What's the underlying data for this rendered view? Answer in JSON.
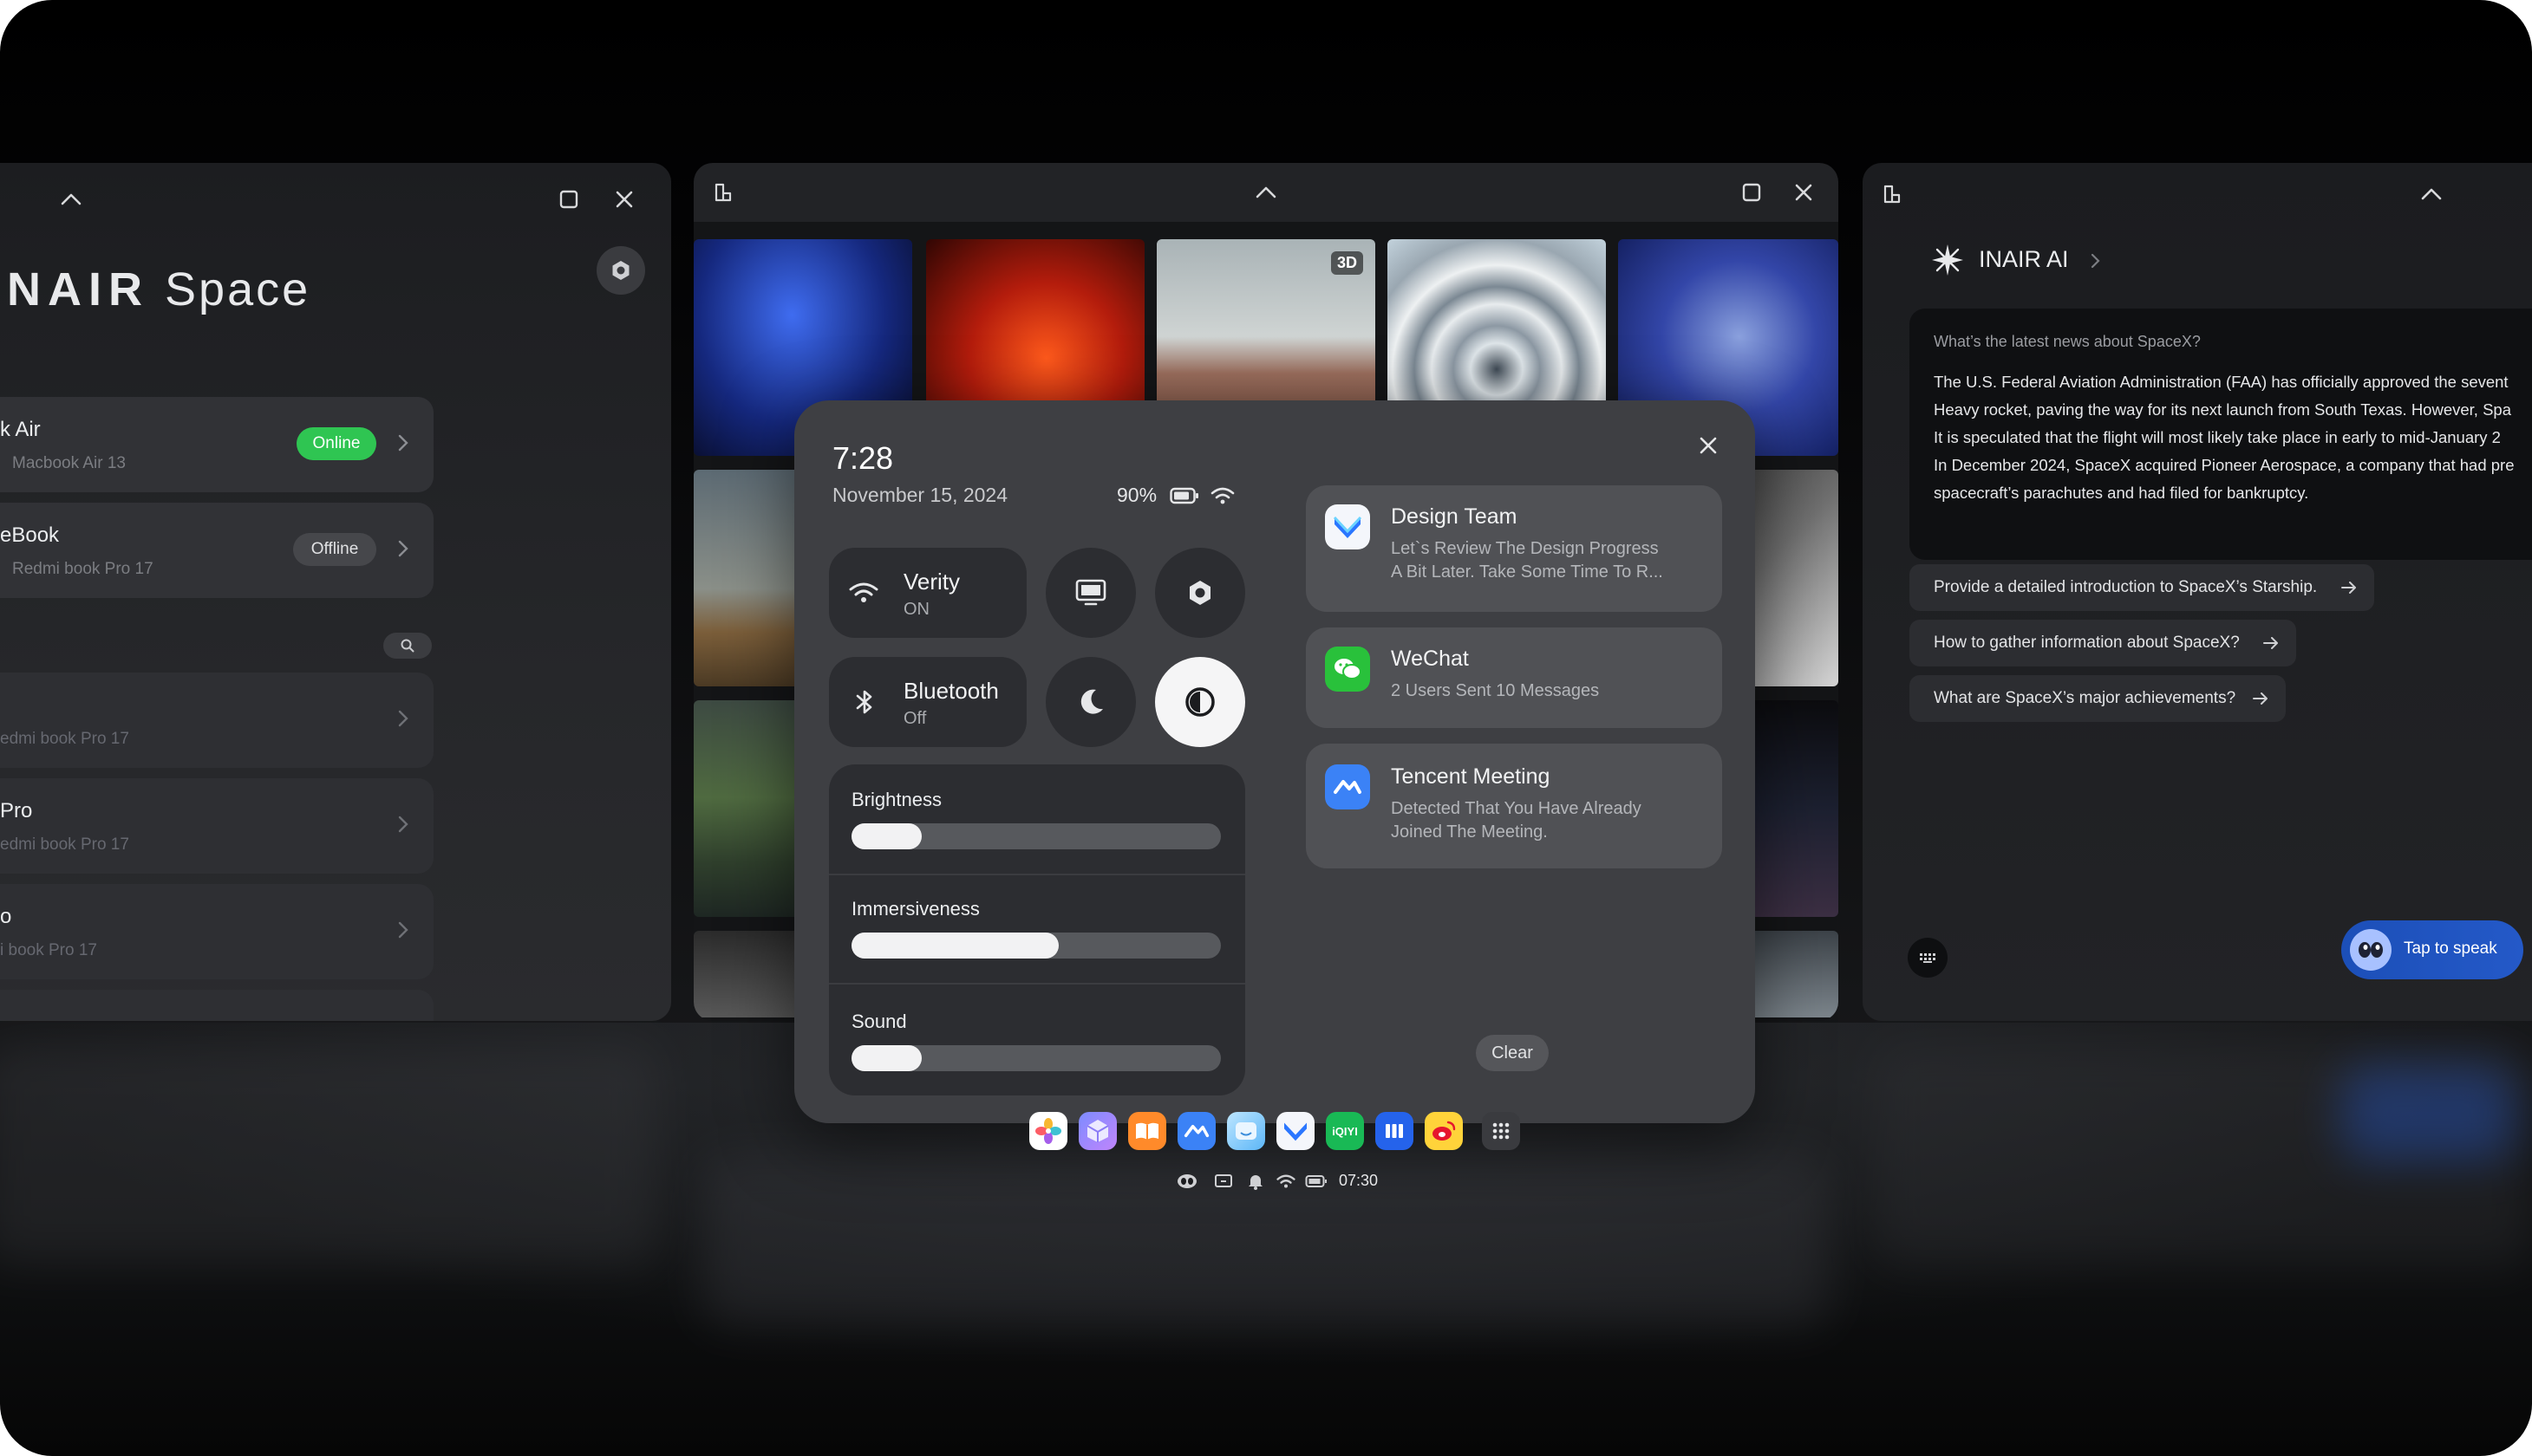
{
  "colors": {
    "online": "#2fc552",
    "accent_blue": "#2459c8",
    "panel": "#3e3f43"
  },
  "left_window": {
    "title_brand": "NAIR",
    "title_rest": "Space",
    "devices": [
      {
        "name": "k Air",
        "sub": "Macbook Air 13",
        "status": "Online"
      },
      {
        "name": "eBook",
        "sub": "Redmi book Pro 17",
        "status": "Offline"
      }
    ],
    "others": [
      {
        "name": "",
        "sub": "edmi book Pro 17"
      },
      {
        "name": "Pro",
        "sub": "edmi book Pro 17"
      },
      {
        "name": "o",
        "sub": "i book Pro 17"
      }
    ]
  },
  "middle_window": {
    "tile_badge": "3D"
  },
  "right_window": {
    "title": "INAIR AI",
    "question": "What’s the latest news about SpaceX?",
    "answer_lines": [
      "The U.S. Federal Aviation Administration (FAA) has officially approved the sevent",
      "Heavy rocket, paving the way for its next launch from South Texas. However, Spa",
      "It is speculated that the flight will most likely take place in early to mid-January 2",
      "In December 2024, SpaceX acquired Pioneer Aerospace, a company that had pre",
      "spacecraft’s parachutes and had filed for bankruptcy."
    ],
    "suggestions": [
      "Provide a detailed introduction to SpaceX’s Starship.",
      "How to gather information about SpaceX?",
      "What are SpaceX’s major achievements?"
    ],
    "speak_label": "Tap to speak"
  },
  "control_panel": {
    "time": "7:28",
    "date": "November 15, 2024",
    "battery": "90%",
    "wifi": {
      "label": "Verity",
      "state": "ON"
    },
    "bluetooth": {
      "label": "Bluetooth",
      "state": "Off"
    },
    "sliders": [
      {
        "label": "Brightness",
        "value": 0.19
      },
      {
        "label": "Immersiveness",
        "value": 0.56
      },
      {
        "label": "Sound",
        "value": 0.19
      }
    ],
    "notifications": [
      {
        "title": "Design Team",
        "body": [
          "Let`s Review The Design Progress",
          "A Bit Later. Take Some Time To R..."
        ]
      },
      {
        "title": "WeChat",
        "body": [
          "2 Users Sent 10 Messages"
        ]
      },
      {
        "title": "Tencent Meeting",
        "body": [
          "Detected That You Have Already",
          "Joined The Meeting."
        ]
      }
    ],
    "clear_label": "Clear"
  },
  "dock": {
    "iqiyi_label": "iQIYI",
    "status_time": "07:30"
  }
}
